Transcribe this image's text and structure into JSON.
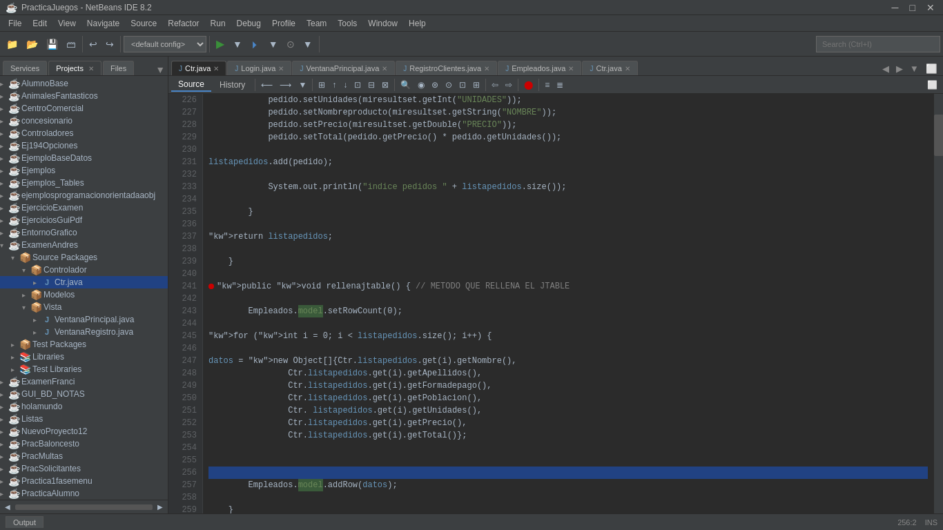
{
  "titlebar": {
    "title": "PracticaJuegos - NetBeans IDE 8.2",
    "controls": [
      "─",
      "□",
      "✕"
    ]
  },
  "menubar": {
    "items": [
      "File",
      "Edit",
      "View",
      "Navigate",
      "Source",
      "Refactor",
      "Run",
      "Debug",
      "Profile",
      "Team",
      "Tools",
      "Window",
      "Help"
    ]
  },
  "toolbar": {
    "config_dropdown": "<default config>",
    "search_placeholder": "Search (Ctrl+I)"
  },
  "left_panel": {
    "tabs": [
      "Services",
      "Projects",
      "Files"
    ],
    "active_tab": "Projects"
  },
  "tree": {
    "items": [
      {
        "id": "AlumnoBase",
        "label": "AlumnoBase",
        "level": 1,
        "type": "project",
        "expanded": false
      },
      {
        "id": "AnimalesFantasticos",
        "label": "AnimalesFantasticos",
        "level": 1,
        "type": "project",
        "expanded": false
      },
      {
        "id": "CentroComercial",
        "label": "CentroComercial",
        "level": 1,
        "type": "project",
        "expanded": false
      },
      {
        "id": "concesionario",
        "label": "concesionario",
        "level": 1,
        "type": "project",
        "expanded": false
      },
      {
        "id": "Controladores",
        "label": "Controladores",
        "level": 1,
        "type": "project",
        "expanded": false
      },
      {
        "id": "Ej194Opciones",
        "label": "Ej194Opciones",
        "level": 1,
        "type": "project",
        "expanded": false
      },
      {
        "id": "EjemploBaseDatos",
        "label": "EjemploBaseDatos",
        "level": 1,
        "type": "project",
        "expanded": false
      },
      {
        "id": "Ejemplos",
        "label": "Ejemplos",
        "level": 1,
        "type": "project",
        "expanded": false
      },
      {
        "id": "Ejemplos_Tables",
        "label": "Ejemplos_Tables",
        "level": 1,
        "type": "project",
        "expanded": false
      },
      {
        "id": "ejemplosprogramacionorientadaaobj",
        "label": "ejemplosprogramacionorientadaaobj",
        "level": 1,
        "type": "project",
        "expanded": false
      },
      {
        "id": "EjercicioExamen",
        "label": "EjercicioExamen",
        "level": 1,
        "type": "project",
        "expanded": false
      },
      {
        "id": "EjerciciosGuiPdf",
        "label": "EjerciciosGuiPdf",
        "level": 1,
        "type": "project",
        "expanded": false
      },
      {
        "id": "EntornoGrafico",
        "label": "EntornoGrafico",
        "level": 1,
        "type": "project",
        "expanded": false
      },
      {
        "id": "ExamenAndres",
        "label": "ExamenAndres",
        "level": 1,
        "type": "project",
        "expanded": true
      },
      {
        "id": "SourcePackages",
        "label": "Source Packages",
        "level": 2,
        "type": "source",
        "expanded": true
      },
      {
        "id": "Controlador",
        "label": "Controlador",
        "level": 3,
        "type": "package",
        "expanded": true
      },
      {
        "id": "Ctr.java",
        "label": "Ctr.java",
        "level": 4,
        "type": "java",
        "expanded": false,
        "selected": true
      },
      {
        "id": "Modelos",
        "label": "Modelos",
        "level": 3,
        "type": "package",
        "expanded": false
      },
      {
        "id": "Vista",
        "label": "Vista",
        "level": 3,
        "type": "package",
        "expanded": true
      },
      {
        "id": "VentanaPrincipal.java",
        "label": "VentanaPrincipal.java",
        "level": 4,
        "type": "java",
        "expanded": false
      },
      {
        "id": "VentanaRegistro.java",
        "label": "VentanaRegistro.java",
        "level": 4,
        "type": "java",
        "expanded": false
      },
      {
        "id": "TestPackages",
        "label": "Test Packages",
        "level": 2,
        "type": "source",
        "expanded": false
      },
      {
        "id": "Libraries",
        "label": "Libraries",
        "level": 2,
        "type": "library",
        "expanded": false
      },
      {
        "id": "TestLibraries",
        "label": "Test Libraries",
        "level": 2,
        "type": "library",
        "expanded": false
      },
      {
        "id": "ExamenFranci",
        "label": "ExamenFranci",
        "level": 1,
        "type": "project",
        "expanded": false
      },
      {
        "id": "GUI_BD_NOTAS",
        "label": "GUI_BD_NOTAS",
        "level": 1,
        "type": "project",
        "expanded": false
      },
      {
        "id": "holamundo",
        "label": "holamundo",
        "level": 1,
        "type": "project",
        "expanded": false
      },
      {
        "id": "Listas",
        "label": "Listas",
        "level": 1,
        "type": "project",
        "expanded": false
      },
      {
        "id": "NuevoProyecto12",
        "label": "NuevoProyecto12",
        "level": 1,
        "type": "project",
        "expanded": false
      },
      {
        "id": "PracBaloncesto",
        "label": "PracBaloncesto",
        "level": 1,
        "type": "project",
        "expanded": false
      },
      {
        "id": "PracMultas",
        "label": "PracMultas",
        "level": 1,
        "type": "project",
        "expanded": false
      },
      {
        "id": "PracSolicitantes",
        "label": "PracSolicitantes",
        "level": 1,
        "type": "project",
        "expanded": false
      },
      {
        "id": "Practica1fasemenu",
        "label": "Practica1fasemenu",
        "level": 1,
        "type": "project",
        "expanded": false
      },
      {
        "id": "PracticaAlumno",
        "label": "PracticaAlumno",
        "level": 1,
        "type": "project",
        "expanded": false
      }
    ]
  },
  "editor": {
    "tabs": [
      {
        "label": "Ctr.java",
        "active": true
      },
      {
        "label": "Login.java",
        "active": false
      },
      {
        "label": "VentanaPrincipal.java",
        "active": false
      },
      {
        "label": "RegistroClientes.java",
        "active": false
      },
      {
        "label": "Empleados.java",
        "active": false
      },
      {
        "label": "Ctr.java",
        "active": false
      }
    ],
    "source_tab": "Source",
    "history_tab": "History"
  },
  "code": {
    "lines": [
      {
        "num": 226,
        "content": "            pedido.setUnidades(miresultset.getInt(\"UNIDADES\"));"
      },
      {
        "num": 227,
        "content": "            pedido.setNombreproducto(miresultset.getString(\"NOMBRE\"));"
      },
      {
        "num": 228,
        "content": "            pedido.setPrecio(miresultset.getDouble(\"PRECIO\"));"
      },
      {
        "num": 229,
        "content": "            pedido.setTotal(pedido.getPrecio() * pedido.getUnidades());"
      },
      {
        "num": 230,
        "content": ""
      },
      {
        "num": 231,
        "content": "            listapedidos.add(pedido);"
      },
      {
        "num": 232,
        "content": ""
      },
      {
        "num": 233,
        "content": "            System.out.println(\"indice pedidos \" + listapedidos.size());"
      },
      {
        "num": 234,
        "content": ""
      },
      {
        "num": 235,
        "content": "        }"
      },
      {
        "num": 236,
        "content": ""
      },
      {
        "num": 237,
        "content": "        return listapedidos;"
      },
      {
        "num": 238,
        "content": ""
      },
      {
        "num": 239,
        "content": "    }"
      },
      {
        "num": 240,
        "content": ""
      },
      {
        "num": 241,
        "content": "    public void rellenajtable() { // METODO QUE RELLENA EL JTABLE"
      },
      {
        "num": 242,
        "content": ""
      },
      {
        "num": 243,
        "content": "        Empleados.model.setRowCount(0);"
      },
      {
        "num": 244,
        "content": ""
      },
      {
        "num": 245,
        "content": "        for (int i = 0; i < listapedidos.size(); i++) {"
      },
      {
        "num": 246,
        "content": ""
      },
      {
        "num": 247,
        "content": "            datos = new Object[]{Ctr.listapedidos.get(i).getNombre(),"
      },
      {
        "num": 248,
        "content": "                Ctr.listapedidos.get(i).getApellidos(),"
      },
      {
        "num": 249,
        "content": "                Ctr.listapedidos.get(i).getFormadepago(),"
      },
      {
        "num": 250,
        "content": "                Ctr.listapedidos.get(i).getPoblacion(),"
      },
      {
        "num": 251,
        "content": "                Ctr. listapedidos.get(i).getUnidades(),"
      },
      {
        "num": 252,
        "content": "                Ctr.listapedidos.get(i).getPrecio(),"
      },
      {
        "num": 253,
        "content": "                Ctr.listapedidos.get(i).getTotal()};"
      },
      {
        "num": 254,
        "content": ""
      },
      {
        "num": 255,
        "content": ""
      },
      {
        "num": 256,
        "content": ""
      },
      {
        "num": 257,
        "content": "        Empleados.model.addRow(datos);"
      },
      {
        "num": 258,
        "content": ""
      },
      {
        "num": 259,
        "content": "    }"
      }
    ]
  },
  "statusbar": {
    "output_label": "Output",
    "position": "256:2",
    "mode": "INS"
  }
}
